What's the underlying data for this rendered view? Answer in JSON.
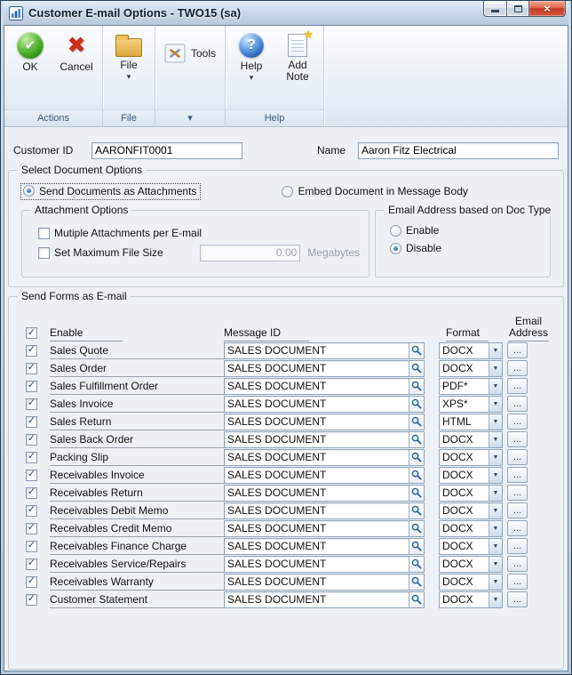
{
  "window": {
    "title": "Customer E-mail Options  -  TWO15 (sa)"
  },
  "icons": {
    "ok_check": "✔",
    "cancel_x": "✖",
    "help_qmark": "?",
    "note_star": "★",
    "caret": "▾",
    "combo_arrow": "▼",
    "check": "✓",
    "close_x": "×"
  },
  "toolbar": {
    "ok": "OK",
    "cancel": "Cancel",
    "file": "File",
    "tools": "Tools",
    "help": "Help",
    "add_note": "Add Note",
    "captions": {
      "actions": "Actions",
      "file": "File",
      "tools": "▾",
      "help": "Help"
    }
  },
  "customer": {
    "id_label": "Customer ID",
    "id_value": "AARONFIT0001",
    "name_label": "Name",
    "name_value": "Aaron Fitz Electrical"
  },
  "document_options": {
    "legend": "Select Document Options",
    "send_as_attachments": "Send Documents as Attachments",
    "embed_in_body": "Embed Document in Message Body",
    "attachment": {
      "legend": "Attachment Options",
      "multiple_attachments": "Mutiple Attachments per E-mail",
      "set_max_file_size": "Set Maximum File Size",
      "max_file_size_value": "0.00",
      "unit": "Megabytes"
    },
    "email_doc_type": {
      "legend": "Email Address based on Doc Type",
      "enable": "Enable",
      "disable": "Disable"
    }
  },
  "send_forms": {
    "legend": "Send Forms as E-mail",
    "headers": {
      "enable": "Enable",
      "message_id": "Message ID",
      "format": "Format",
      "email_line1": "Email",
      "email_line2": "Address"
    },
    "email_button_label": "...",
    "rows": [
      {
        "label": "Sales Quote",
        "message_id": "SALES DOCUMENT",
        "format": "DOCX"
      },
      {
        "label": "Sales Order",
        "message_id": "SALES DOCUMENT",
        "format": "DOCX"
      },
      {
        "label": "Sales Fulfillment Order",
        "message_id": "SALES DOCUMENT",
        "format": "PDF*"
      },
      {
        "label": "Sales Invoice",
        "message_id": "SALES DOCUMENT",
        "format": "XPS*"
      },
      {
        "label": "Sales Return",
        "message_id": "SALES DOCUMENT",
        "format": "HTML"
      },
      {
        "label": "Sales Back Order",
        "message_id": "SALES DOCUMENT",
        "format": "DOCX"
      },
      {
        "label": "Packing Slip",
        "message_id": "SALES DOCUMENT",
        "format": "DOCX"
      },
      {
        "label": "Receivables Invoice",
        "message_id": "SALES DOCUMENT",
        "format": "DOCX"
      },
      {
        "label": "Receivables Return",
        "message_id": "SALES DOCUMENT",
        "format": "DOCX"
      },
      {
        "label": "Receivables Debit Memo",
        "message_id": "SALES DOCUMENT",
        "format": "DOCX"
      },
      {
        "label": "Receivables Credit Memo",
        "message_id": "SALES DOCUMENT",
        "format": "DOCX"
      },
      {
        "label": "Receivables Finance Charge",
        "message_id": "SALES DOCUMENT",
        "format": "DOCX"
      },
      {
        "label": "Receivables Service/Repairs",
        "message_id": "SALES DOCUMENT",
        "format": "DOCX"
      },
      {
        "label": "Receivables Warranty",
        "message_id": "SALES DOCUMENT",
        "format": "DOCX"
      },
      {
        "label": "Customer Statement",
        "message_id": "SALES DOCUMENT",
        "format": "DOCX"
      }
    ]
  }
}
